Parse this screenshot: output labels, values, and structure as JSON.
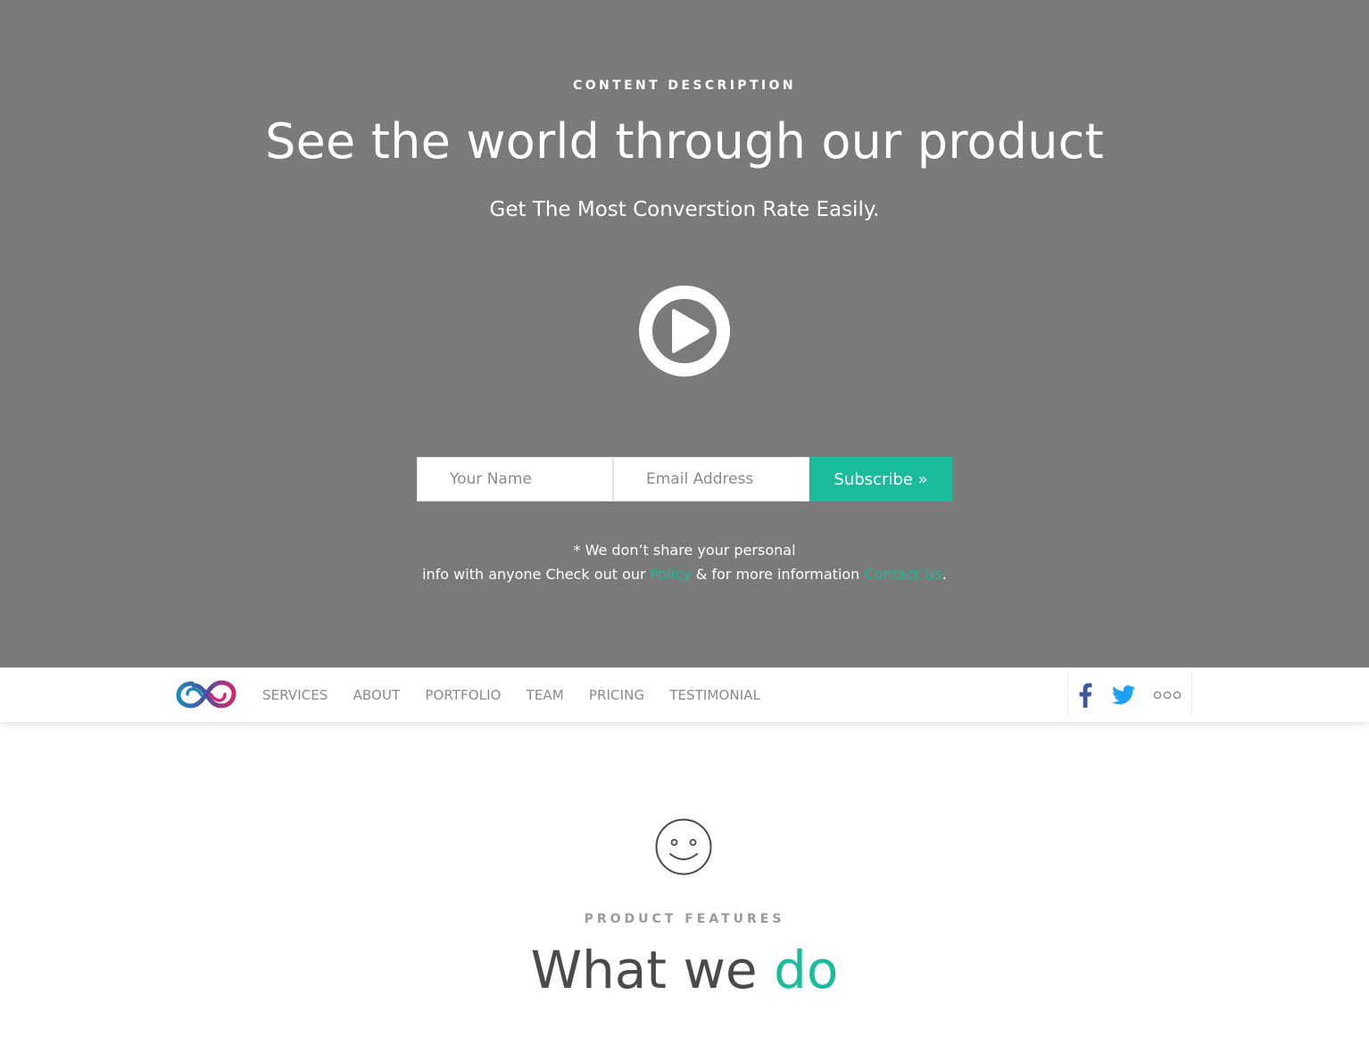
{
  "hero": {
    "eyebrow": "CONTENT DESCRIPTION",
    "headline": "See the world through our product",
    "subline": "Get The Most Converstion Rate Easily.",
    "play_icon": "play-circle-icon",
    "form": {
      "name_placeholder": "Your Name",
      "email_placeholder": "Email Address",
      "subscribe_label": "Subscribe »"
    },
    "note": {
      "line1": "* We don’t share your personal",
      "line2_prefix": "info with anyone Check out our",
      "policy_link": "Policy",
      "line2_middle": "& for more information",
      "contact_link": "Contact Us",
      "line2_suffix": "."
    }
  },
  "nav": {
    "logo_icon": "infinity-logo-icon",
    "items": [
      {
        "label": "SERVICES"
      },
      {
        "label": "ABOUT"
      },
      {
        "label": "PORTFOLIO"
      },
      {
        "label": "TEAM"
      },
      {
        "label": "PRICING"
      },
      {
        "label": "TESTIMONIAL"
      }
    ],
    "social": [
      {
        "icon": "facebook-icon"
      },
      {
        "icon": "twitter-icon"
      },
      {
        "icon": "more-dots-icon"
      }
    ]
  },
  "features": {
    "icon": "smiley-face-icon",
    "eyebrow": "PRODUCT FEATURES",
    "title_main": "What we",
    "title_accent": "do"
  },
  "colors": {
    "hero_bg": "#7a7a7a",
    "accent": "#1abc9c",
    "nav_text": "#8a8a8a",
    "facebook": "#3b5998",
    "twitter": "#1da1f2",
    "logo_blue": "#1e6fa8",
    "logo_pink": "#d6246e"
  }
}
